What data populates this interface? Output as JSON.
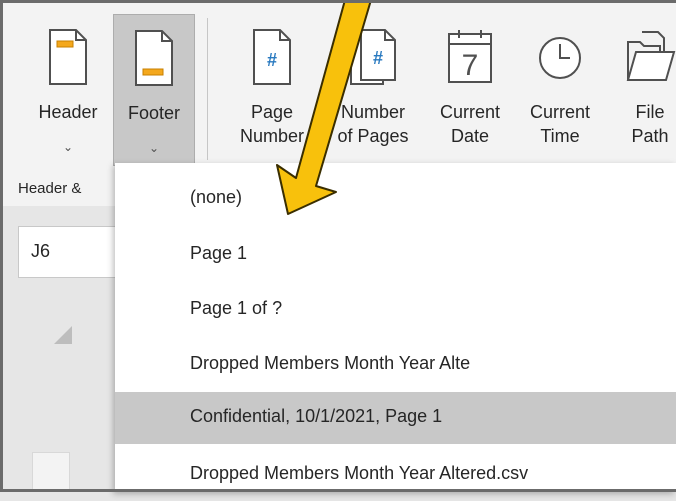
{
  "ribbon": {
    "buttons": [
      {
        "id": "header",
        "label": "Header",
        "sub": "",
        "chevron": "⌄",
        "icon": "header-icon"
      },
      {
        "id": "footer",
        "label": "Footer",
        "sub": "",
        "chevron": "⌄",
        "icon": "footer-icon",
        "active": true
      },
      {
        "id": "page-number",
        "label": "Page",
        "sub": "Number",
        "icon": "page-number-icon"
      },
      {
        "id": "number-of-pages",
        "label": "Number",
        "sub": "of Pages",
        "icon": "number-of-pages-icon"
      },
      {
        "id": "current-date",
        "label": "Current",
        "sub": "Date",
        "icon": "calendar-icon",
        "calendar_day": "7"
      },
      {
        "id": "current-time",
        "label": "Current",
        "sub": "Time",
        "icon": "clock-icon"
      },
      {
        "id": "file-path",
        "label": "File",
        "sub": "Path",
        "icon": "folder-icon"
      }
    ],
    "group_label": "Header &",
    "hash_glyph": "#"
  },
  "namebox": {
    "value": "J6"
  },
  "footer_menu": {
    "items": [
      {
        "label": "(none)"
      },
      {
        "label": "Page 1"
      },
      {
        "label": "Page 1 of ?"
      },
      {
        "label": "Dropped Members Month Year Alte"
      },
      {
        "label": "Confidential, 10/1/2021, Page 1",
        "selected": true
      },
      {
        "label": "Dropped Members Month Year Altered.csv"
      }
    ]
  },
  "colors": {
    "accent_orange": "#f4a81d",
    "icon_blue": "#2a7ac0",
    "arrow_fill": "#f8c10c",
    "arrow_stroke": "#3a2e00",
    "selected_bg": "#c8c8c8"
  }
}
